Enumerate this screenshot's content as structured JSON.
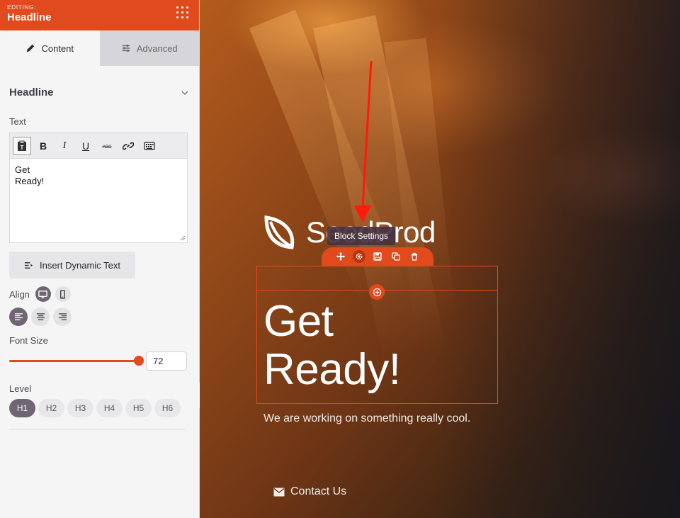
{
  "sidebar": {
    "editing_label": "EDITING:",
    "title": "Headline",
    "tabs": [
      {
        "label": "Content",
        "active": true
      },
      {
        "label": "Advanced",
        "active": false
      }
    ],
    "section_title": "Headline",
    "text_label": "Text",
    "editor_lines": [
      "Get",
      "Ready!"
    ],
    "dynamic_text_button": "Insert Dynamic Text",
    "align_label": "Align",
    "font_size_label": "Font Size",
    "font_size_value": "72",
    "font_size_fill": 0.95,
    "level_label": "Level",
    "levels": [
      {
        "label": "H1",
        "active": true
      },
      {
        "label": "H2",
        "active": false
      },
      {
        "label": "H3",
        "active": false
      },
      {
        "label": "H4",
        "active": false
      },
      {
        "label": "H5",
        "active": false
      },
      {
        "label": "H6",
        "active": false
      }
    ]
  },
  "canvas": {
    "logo_text": "SeedProd",
    "tooltip": "Block Settings",
    "headline_lines": [
      "Get",
      "Ready!"
    ],
    "subtext": "We are working on something really cool.",
    "contact_label": "Contact Us"
  },
  "colors": {
    "accent": "#e04a1c",
    "active_pill": "#6f6673",
    "annotation_arrow": "#ff1a0a"
  },
  "icons": {
    "grid": "dots-grid-icon",
    "content_tab": "pencil-icon",
    "advanced_tab": "sliders-icon",
    "collapse": "chevron-down-icon",
    "block_tools": [
      "move-icon",
      "gear-icon",
      "save-icon",
      "duplicate-icon",
      "trash-icon"
    ]
  }
}
